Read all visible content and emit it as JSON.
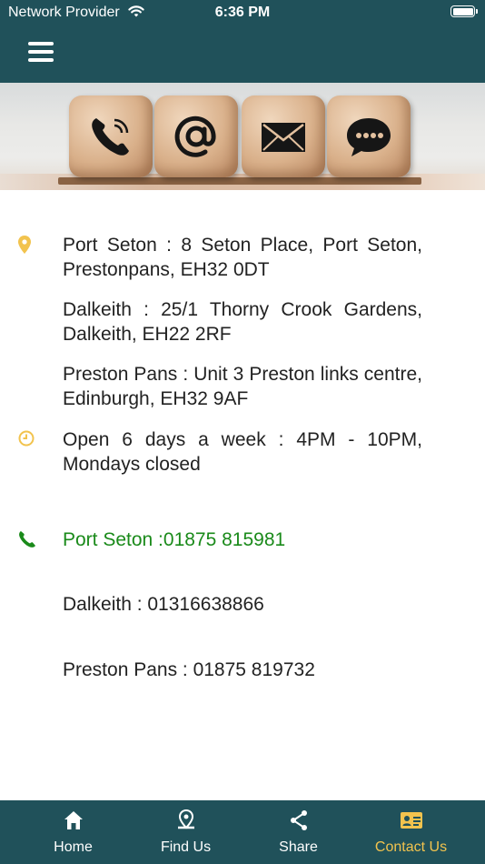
{
  "status_bar": {
    "carrier": "Network Provider",
    "time": "6:36 PM"
  },
  "header": {
    "menu_icon": "hamburger-menu-icon"
  },
  "banner": {
    "icons": [
      "phone-icon",
      "at-sign-icon",
      "envelope-icon",
      "chat-bubble-icon"
    ]
  },
  "contact": {
    "addresses": [
      "Port Seton : 8 Seton Place, Port Seton, Prestonpans, EH32 0DT",
      "Dalkeith : 25/1 Thorny Crook Gardens, Dalkeith, EH22 2RF",
      "Preston Pans : Unit 3 Preston links centre, Edinburgh, EH32 9AF"
    ],
    "hours": "Open 6 days a week : 4PM - 10PM, Mondays closed",
    "phones": [
      "Port Seton :01875 815981",
      "Dalkeith : 01316638866",
      "Preston Pans : 01875 819732"
    ]
  },
  "tabbar": {
    "tabs": [
      {
        "label": "Home",
        "icon": "home-icon"
      },
      {
        "label": "Find Us",
        "icon": "map-pin-icon"
      },
      {
        "label": "Share",
        "icon": "share-icon"
      },
      {
        "label": "Contact Us",
        "icon": "contact-card-icon",
        "active": true
      }
    ]
  },
  "colors": {
    "header_bg": "#20515a",
    "accent_yellow": "#f2c34e",
    "phone_green": "#1a8a1a"
  }
}
